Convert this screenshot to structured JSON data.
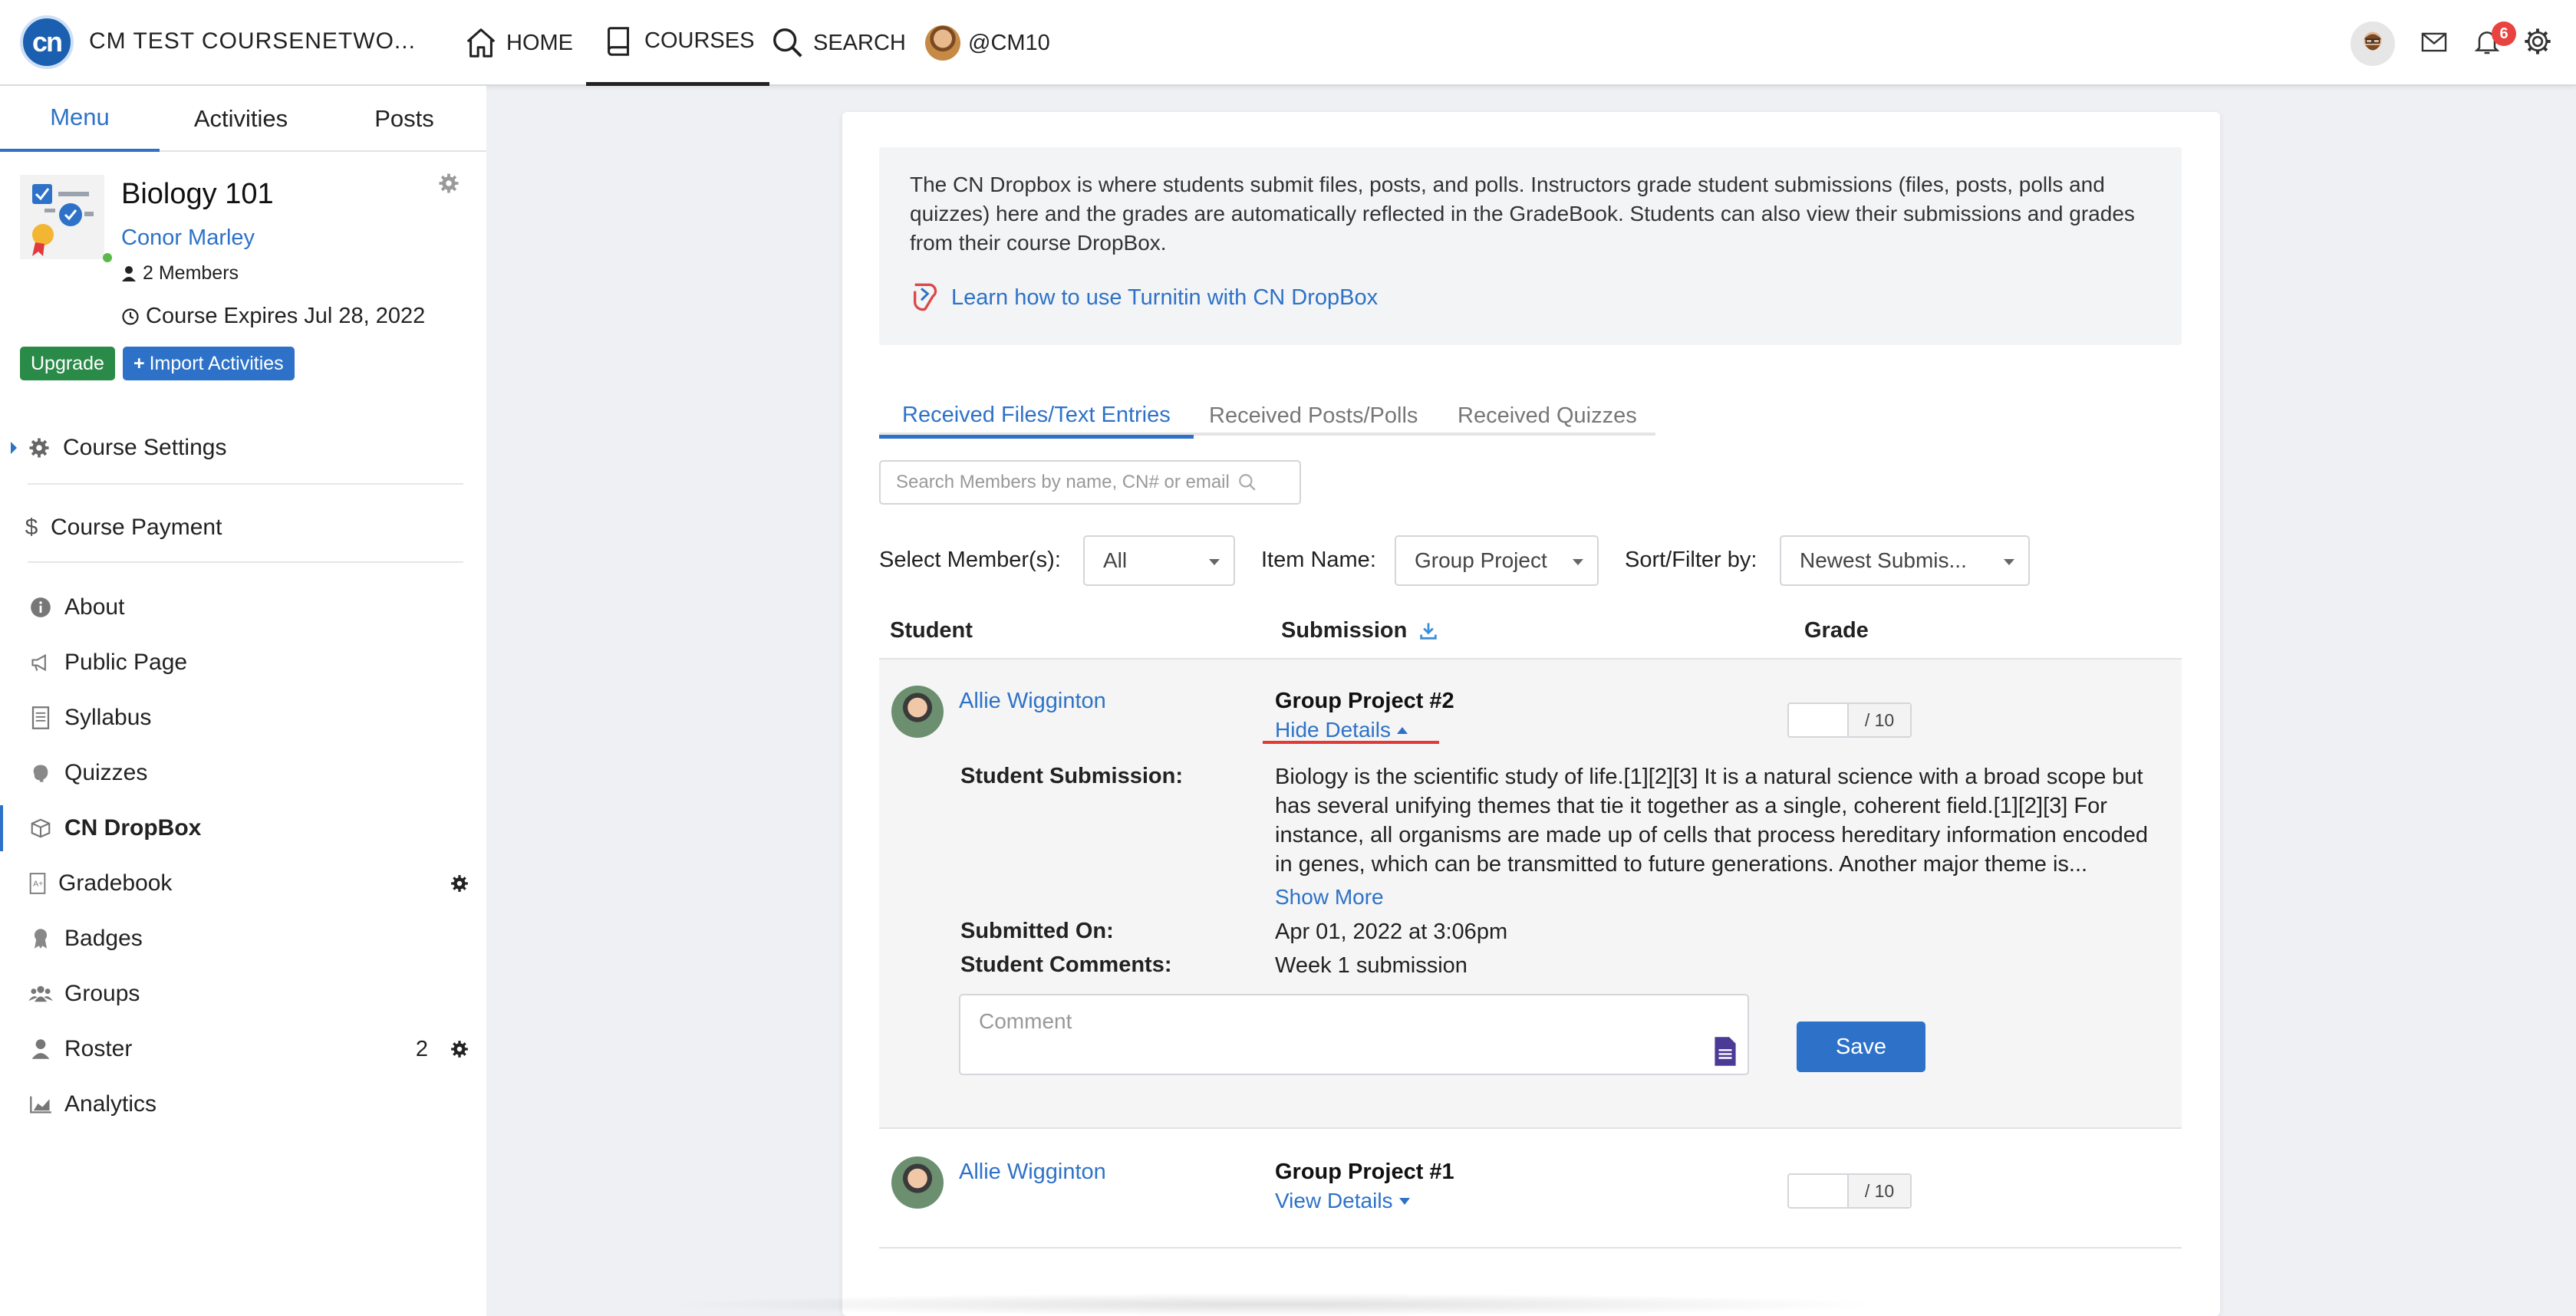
{
  "topbar": {
    "logo_text": "cn",
    "brand": "CM TEST COURSENETWO...",
    "nav": {
      "home": "HOME",
      "courses": "COURSES",
      "search": "SEARCH",
      "profile": "@CM10"
    },
    "notification_count": "6"
  },
  "sidebar": {
    "tabs": [
      "Menu",
      "Activities",
      "Posts"
    ],
    "course": {
      "title": "Biology 101",
      "owner": "Conor Marley",
      "members": "2 Members",
      "expires": "Course Expires Jul 28, 2022"
    },
    "buttons": {
      "upgrade": "Upgrade",
      "import": "Import Activities"
    },
    "items": {
      "course_settings": "Course Settings",
      "course_payment": "Course Payment",
      "about": "About",
      "public_page": "Public Page",
      "syllabus": "Syllabus",
      "quizzes": "Quizzes",
      "dropbox": "CN DropBox",
      "gradebook": "Gradebook",
      "badges": "Badges",
      "groups": "Groups",
      "roster": "Roster",
      "roster_count": "2",
      "analytics": "Analytics"
    }
  },
  "main": {
    "info_text": "The CN Dropbox is where students submit files, posts, and polls. Instructors grade student submissions (files, posts, polls and quizzes) here and the grades are automatically reflected in the GradeBook. Students can also view their submissions and grades from their course DropBox.",
    "turnitin_link": "Learn how to use Turnitin with CN DropBox",
    "tabs": [
      "Received Files/Text Entries",
      "Received Posts/Polls",
      "Received Quizzes"
    ],
    "search_placeholder": "Search Members by name, CN# or email",
    "filters": {
      "member_label": "Select Member(s):",
      "member_value": "All",
      "item_label": "Item Name:",
      "item_value": "Group Project",
      "sort_label": "Sort/Filter by:",
      "sort_value": "Newest Submis..."
    },
    "columns": {
      "student": "Student",
      "submission": "Submission",
      "grade": "Grade"
    },
    "submissions": [
      {
        "student": "Allie Wigginton",
        "title": "Group Project #2",
        "toggle": "Hide Details",
        "grade_of": "/ 10",
        "student_submission_label": "Student Submission:",
        "student_submission": "Biology is the scientific study of life.[1][2][3] It is a natural science with a broad scope but has several unifying themes that tie it together as a single, coherent field.[1][2][3] For instance, all organisms are made up of cells that process hereditary information encoded in genes, which can be transmitted to future generations. Another major theme is...",
        "show_more": "Show More",
        "submitted_on_label": "Submitted On:",
        "submitted_on": "Apr 01, 2022 at 3:06pm",
        "comments_label": "Student Comments:",
        "comments": "Week 1 submission",
        "comment_placeholder": "Comment",
        "save": "Save"
      },
      {
        "student": "Allie Wigginton",
        "title": "Group Project #1",
        "toggle": "View Details",
        "grade_of": "/ 10"
      }
    ]
  },
  "colors": {
    "accent": "#2d72c8",
    "upgrade": "#2a8a48",
    "badge": "#e8433f",
    "underline": "#e43a35"
  }
}
